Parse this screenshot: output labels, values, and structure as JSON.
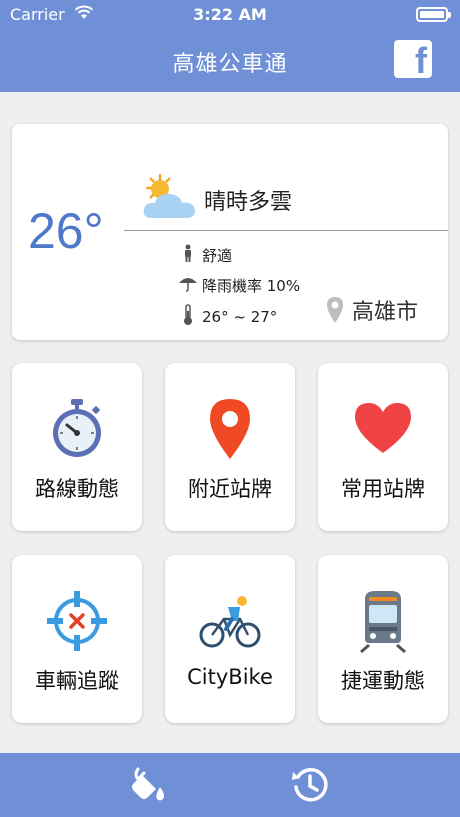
{
  "status": {
    "carrier": "Carrier",
    "time": "3:22 AM"
  },
  "nav": {
    "title": "高雄公車通",
    "fb": "f"
  },
  "weather": {
    "temp": "26°",
    "condition": "晴時多雲",
    "comfort": "舒適",
    "rain": "降雨機率 10%",
    "range": "26° ~ 27°",
    "city": "高雄市",
    "icon": "partly-cloudy-icon"
  },
  "tiles": [
    {
      "label": "路線動態",
      "icon": "stopwatch-icon"
    },
    {
      "label": "附近站牌",
      "icon": "map-pin-icon"
    },
    {
      "label": "常用站牌",
      "icon": "heart-icon"
    },
    {
      "label": "車輛追蹤",
      "icon": "crosshair-icon"
    },
    {
      "label": "CityBike",
      "icon": "cyclist-icon"
    },
    {
      "label": "捷運動態",
      "icon": "metro-train-icon"
    }
  ],
  "tabbar": {
    "left_icon": "paint-bucket-icon",
    "right_icon": "clock-history-icon"
  },
  "colors": {
    "accent": "#6f8fd6",
    "temp": "#4e78c9",
    "pin": "#f04a24",
    "heart": "#f04444"
  }
}
